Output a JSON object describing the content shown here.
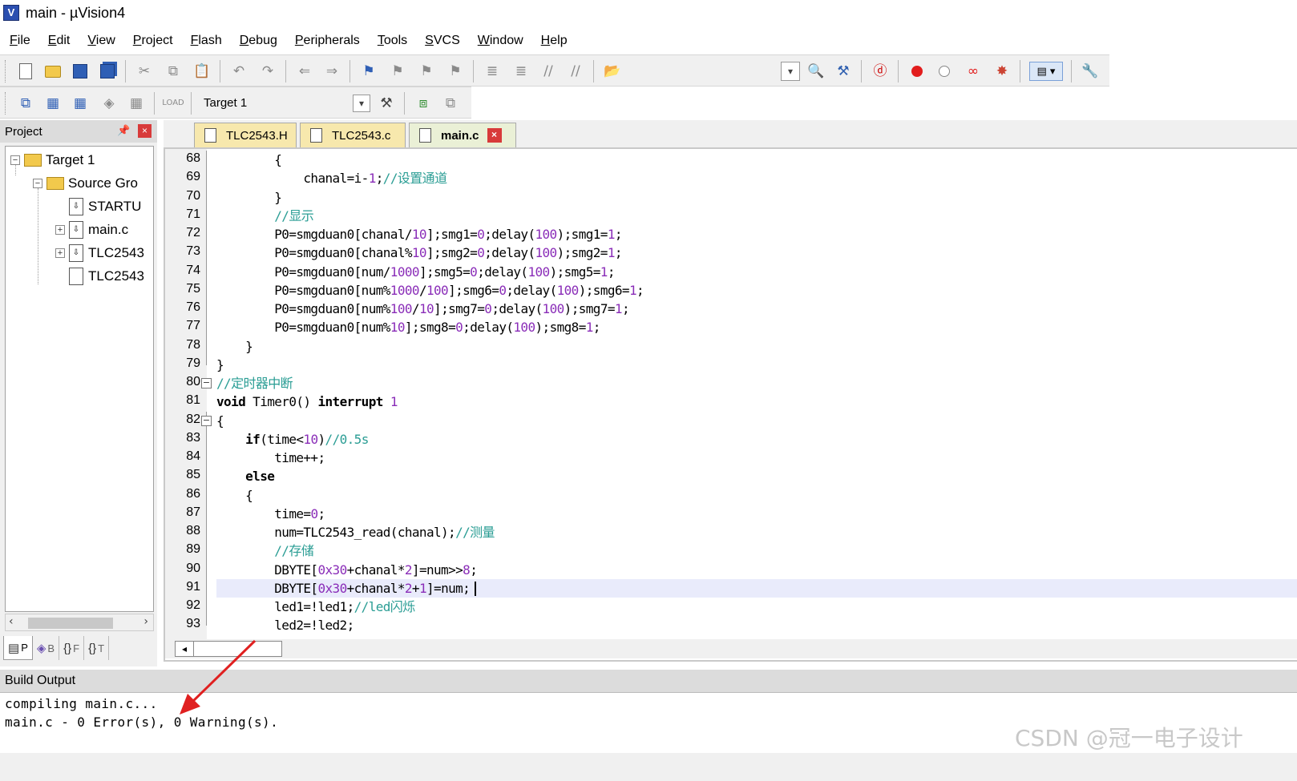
{
  "window": {
    "title": "main  - µVision4",
    "app_icon_letter": "V"
  },
  "menu": [
    "File",
    "Edit",
    "View",
    "Project",
    "Flash",
    "Debug",
    "Peripherals",
    "Tools",
    "SVCS",
    "Window",
    "Help"
  ],
  "toolbar": {
    "target_label": "Target 1"
  },
  "project_panel": {
    "title": "Project",
    "tree": {
      "target": "Target 1",
      "group": "Source Gro",
      "files": [
        "STARTU",
        "main.c",
        "TLC2543",
        "TLC2543"
      ]
    },
    "tabs": [
      "P",
      "B",
      "F",
      "T"
    ]
  },
  "editor": {
    "tabs": [
      "TLC2543.H",
      "TLC2543.c",
      "main.c"
    ],
    "active_tab": "main.c",
    "current_line": 91,
    "line_numbers": [
      "68",
      "69",
      "70",
      "71",
      "72",
      "73",
      "74",
      "75",
      "76",
      "77",
      "78",
      "79",
      "80",
      "81",
      "82",
      "83",
      "84",
      "85",
      "86",
      "87",
      "88",
      "89",
      "90",
      "91",
      "92",
      "93"
    ],
    "code_lines": [
      "        {",
      "            chanal=i-1;//设置通道",
      "        }",
      "        //显示",
      "        P0=smgduan0[chanal/10];smg1=0;delay(100);smg1=1;",
      "        P0=smgduan0[chanal%10];smg2=0;delay(100);smg2=1;",
      "        P0=smgduan0[num/1000];smg5=0;delay(100);smg5=1;",
      "        P0=smgduan0[num%1000/100];smg6=0;delay(100);smg6=1;",
      "        P0=smgduan0[num%100/10];smg7=0;delay(100);smg7=1;",
      "        P0=smgduan0[num%10];smg8=0;delay(100);smg8=1;",
      "    }",
      "}",
      "//定时器中断",
      "void Timer0() interrupt 1",
      "{",
      "    if(time<10)//0.5s",
      "        time++;",
      "    else",
      "    {",
      "        time=0;",
      "        num=TLC2543_read(chanal);//测量",
      "        //存储",
      "        DBYTE[0x30+chanal*2]=num>>8;",
      "        DBYTE[0x30+chanal*2+1]=num;",
      "        led1=!led1;//led闪烁",
      "        led2=!led2;"
    ]
  },
  "build_output": {
    "title": "Build Output",
    "lines": [
      "compiling main.c...",
      "main.c - 0 Error(s), 0 Warning(s)."
    ]
  },
  "watermark": "CSDN @冠一电子设计",
  "colors": {
    "comment": "#2a9d94",
    "number": "#8a2db8",
    "current_line_bg": "#e9ebfb",
    "annotation_arrow": "#e02020"
  }
}
